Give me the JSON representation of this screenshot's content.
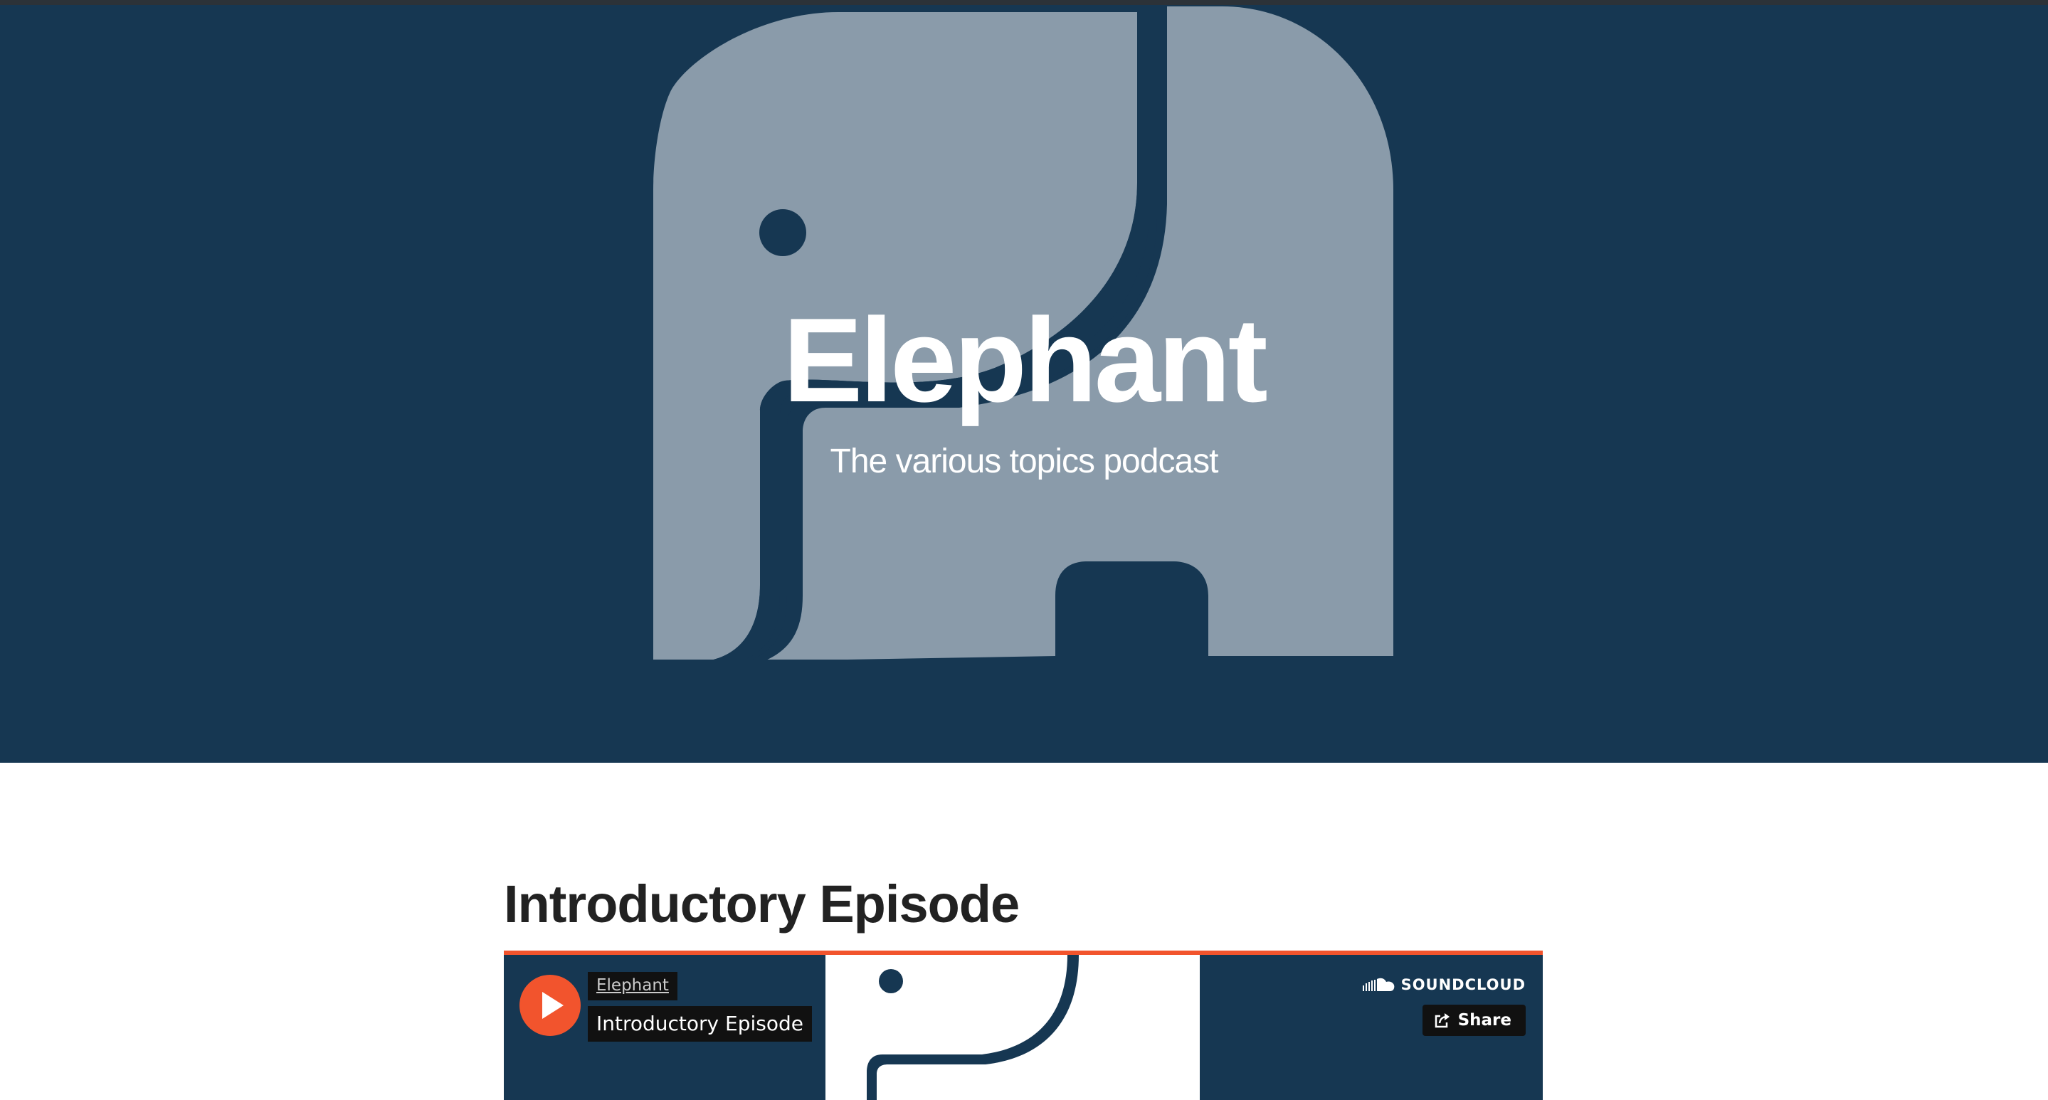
{
  "hero": {
    "title": "Elephant",
    "subtitle": "The various topics podcast",
    "logo_icon": "elephant-logo-icon",
    "background_color": "#163752",
    "logo_color": "#8a9baa"
  },
  "episode": {
    "heading": "Introductory Episode"
  },
  "player": {
    "uploader": "Elephant",
    "track_title": "Introductory Episode",
    "brand": "SOUNDCLOUD",
    "share_label": "Share",
    "play_icon": "play-icon",
    "brand_icon": "soundcloud-icon",
    "share_icon": "share-icon",
    "accent_color": "#f2542d"
  }
}
